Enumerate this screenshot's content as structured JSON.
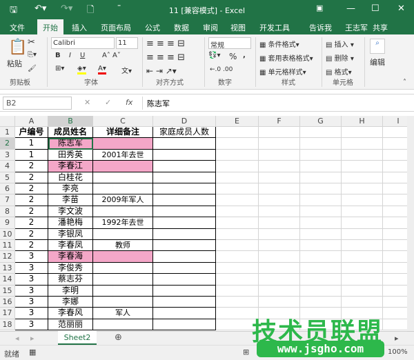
{
  "window": {
    "title": "11  [兼容模式] - Excel"
  },
  "menu_tabs": [
    "文件",
    "开始",
    "插入",
    "页面布局",
    "公式",
    "数据",
    "审阅",
    "视图",
    "开发工具",
    "告诉我",
    "王志军",
    "共享"
  ],
  "active_tab": "开始",
  "ribbon": {
    "clipboard": {
      "paste": "粘贴",
      "group": "剪贴板"
    },
    "font": {
      "name": "Calibri",
      "size": "11",
      "bold": "B",
      "italic": "I",
      "underline": "U",
      "group": "字体"
    },
    "alignment": {
      "group": "对齐方式"
    },
    "number": {
      "format": "常规",
      "percent": "%",
      "comma": ",",
      "group": "数字"
    },
    "styles": {
      "conditional": "条件格式",
      "table": "套用表格格式",
      "cell": "单元格样式",
      "group": "样式"
    },
    "cells": {
      "insert": "插入",
      "delete": "删除",
      "format": "格式",
      "group": "单元格"
    },
    "editing": {
      "label": "编辑"
    }
  },
  "formula_bar": {
    "name_box": "B2",
    "fx": "fx",
    "value": "陈志军"
  },
  "columns": [
    "A",
    "B",
    "C",
    "D",
    "E",
    "F",
    "G",
    "H",
    "I"
  ],
  "selected_cell": "B2",
  "highlight_color": "#f4a7c8",
  "rows": [
    [
      "户编号",
      "成员姓名",
      "详细备注",
      "家庭成员人数"
    ],
    [
      "1",
      "陈志军",
      "",
      ""
    ],
    [
      "1",
      "田秀英",
      "2001年去世",
      ""
    ],
    [
      "2",
      "李春江",
      "",
      ""
    ],
    [
      "2",
      "白桂花",
      "",
      ""
    ],
    [
      "2",
      "李亮",
      "",
      ""
    ],
    [
      "2",
      "李苗",
      "2009年军人",
      ""
    ],
    [
      "2",
      "李文波",
      "",
      ""
    ],
    [
      "2",
      "潘艳梅",
      "1992年去世",
      ""
    ],
    [
      "2",
      "李银凤",
      "",
      ""
    ],
    [
      "2",
      "李春凤",
      "教师",
      ""
    ],
    [
      "3",
      "李春海",
      "",
      ""
    ],
    [
      "3",
      "李俊秀",
      "",
      ""
    ],
    [
      "3",
      "蔡志芬",
      "",
      ""
    ],
    [
      "3",
      "李明",
      "",
      ""
    ],
    [
      "3",
      "李娜",
      "",
      ""
    ],
    [
      "3",
      "李春风",
      "军人",
      ""
    ],
    [
      "3",
      "范丽丽",
      "",
      ""
    ]
  ],
  "highlighted_rows": [
    2,
    4,
    12
  ],
  "sheet_tabs": [
    "Sheet2"
  ],
  "status": {
    "ready": "就绪",
    "zoom": "100%"
  },
  "watermark": {
    "text": "技术员联盟",
    "url": "www.jsgho.com"
  }
}
